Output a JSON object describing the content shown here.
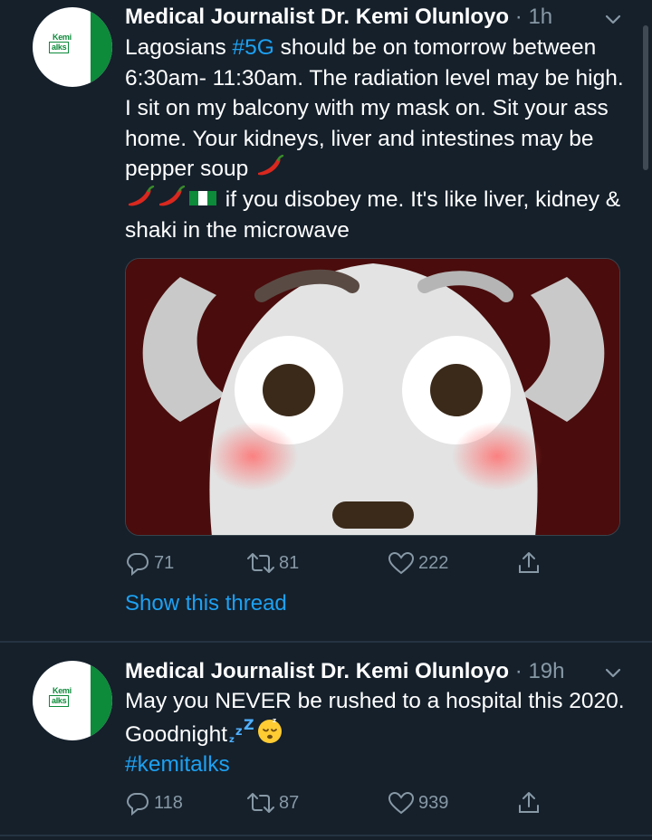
{
  "tweets": [
    {
      "author": "Medical Journalist Dr. Kemi Olunloyo",
      "separator": "·",
      "time": "1h",
      "text_parts": {
        "p1": "Lagosians ",
        "hashtag": "#5G",
        "p2": " should be on tomorrow between 6:30am- 11:30am. The radiation level may be high. I sit on my balcony with my mask on. Sit your ass home. Your kidneys, liver and intestines may be pepper soup ",
        "p3": " if you disobey me. It's like liver, kidney & shaki in the microwave"
      },
      "media": "flushed-face emoji image",
      "replies": "71",
      "retweets": "81",
      "likes": "222",
      "show_thread": "Show this thread"
    },
    {
      "author": "Medical Journalist Dr. Kemi Olunloyo",
      "separator": "·",
      "time": "19h",
      "text_parts": {
        "p1": "May you NEVER be rushed to a hospital this 2020. Goodnight",
        "hashtag": "#kemitalks"
      },
      "replies": "118",
      "retweets": "87",
      "likes": "939"
    }
  ],
  "avatar": {
    "logo_top": "Kemi",
    "logo_box": "alks"
  },
  "icons": {
    "reply": "reply-icon",
    "retweet": "retweet-icon",
    "like": "heart-icon",
    "share": "share-icon",
    "caret": "chevron-down-icon",
    "pepper": "hot-pepper-emoji",
    "flag": "nigeria-flag-emoji",
    "sleep": "zzz-emoji",
    "sleeping_face": "sleeping-face-emoji"
  },
  "colors": {
    "background": "#15202b",
    "accent": "#1da1f2",
    "muted": "#8899a6",
    "avatar_green": "#0d8a3a"
  }
}
